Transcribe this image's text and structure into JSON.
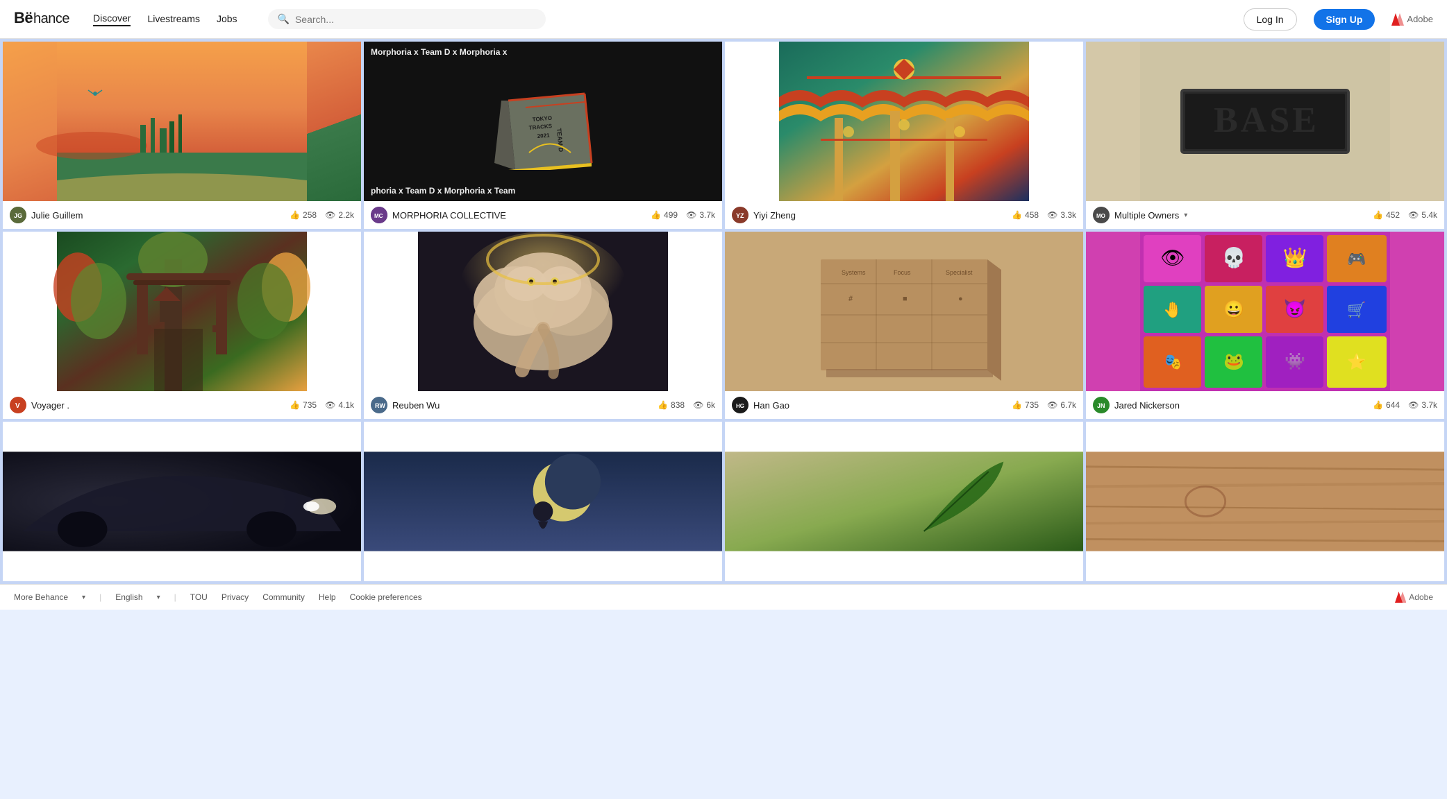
{
  "header": {
    "logo": "Bë",
    "logo_full": "Behance",
    "nav": [
      {
        "label": "Discover",
        "active": true
      },
      {
        "label": "Livestreams",
        "active": false
      },
      {
        "label": "Jobs",
        "active": false
      }
    ],
    "search_placeholder": "Search...",
    "login_label": "Log In",
    "signup_label": "Sign Up",
    "adobe_label": "Adobe"
  },
  "gallery": {
    "rows": [
      [
        {
          "id": 1,
          "author": "Julie Guillem",
          "author_initials": "JG",
          "author_color": "#5a6a3a",
          "likes": "258",
          "views": "2.2k",
          "bg_class": "card-1",
          "type": "illustration"
        },
        {
          "id": 2,
          "author": "MORPHORIA COLLECTIVE",
          "author_initials": "MC",
          "author_color": "#6a3a8a",
          "likes": "499",
          "views": "3.7k",
          "bg_class": "card-2",
          "type": "book",
          "title1": "Morphoria x Team D x Morphoria x",
          "subtitle": "phoria x Team D x Morphoria x Team"
        },
        {
          "id": 3,
          "author": "Yiyi Zheng",
          "author_initials": "YZ",
          "author_color": "#8a3a2a",
          "likes": "458",
          "views": "3.3k",
          "bg_class": "card-3",
          "type": "architecture"
        },
        {
          "id": 4,
          "author": "Multiple Owners",
          "author_initials": "MO",
          "author_color": "#4a4a4a",
          "likes": "452",
          "views": "5.4k",
          "bg_class": "card-4",
          "type": "base-sign",
          "has_dropdown": true
        }
      ],
      [
        {
          "id": 5,
          "author": "Voyager .",
          "author_initials": "V",
          "author_color": "#c84020",
          "likes": "735",
          "views": "4.1k",
          "bg_class": "card-5",
          "type": "torii"
        },
        {
          "id": 6,
          "author": "Reuben Wu",
          "author_initials": "RW",
          "author_color": "#4a6a8a",
          "likes": "838",
          "views": "6k",
          "bg_class": "card-6",
          "type": "cloud"
        },
        {
          "id": 7,
          "author": "Han Gao",
          "author_initials": "HG",
          "author_color": "#1a1a1a",
          "likes": "735",
          "views": "6.7k",
          "bg_class": "card-7",
          "type": "stationery"
        },
        {
          "id": 8,
          "author": "Jared Nickerson",
          "author_initials": "JN",
          "author_color": "#2a8a2a",
          "likes": "644",
          "views": "3.7k",
          "bg_class": "card-8",
          "type": "nft"
        }
      ],
      [
        {
          "id": 9,
          "author": "",
          "author_initials": "",
          "author_color": "#1a1a1a",
          "likes": "",
          "views": "",
          "bg_class": "card-9",
          "type": "car"
        },
        {
          "id": 10,
          "author": "",
          "author_initials": "",
          "author_color": "#3a5a8a",
          "likes": "",
          "views": "",
          "bg_class": "card-10",
          "type": "moon"
        },
        {
          "id": 11,
          "author": "",
          "author_initials": "",
          "author_color": "#4a7a3a",
          "likes": "",
          "views": "",
          "bg_class": "card-11",
          "type": "leaf"
        },
        {
          "id": 12,
          "author": "",
          "author_initials": "",
          "author_color": "#8a5a2a",
          "likes": "",
          "views": "",
          "bg_class": "card-12",
          "type": "wood"
        }
      ]
    ]
  },
  "footer": {
    "more_behance": "More Behance",
    "language": "English",
    "tou": "TOU",
    "privacy": "Privacy",
    "community": "Community",
    "help": "Help",
    "cookie": "Cookie preferences",
    "adobe": "Adobe"
  }
}
